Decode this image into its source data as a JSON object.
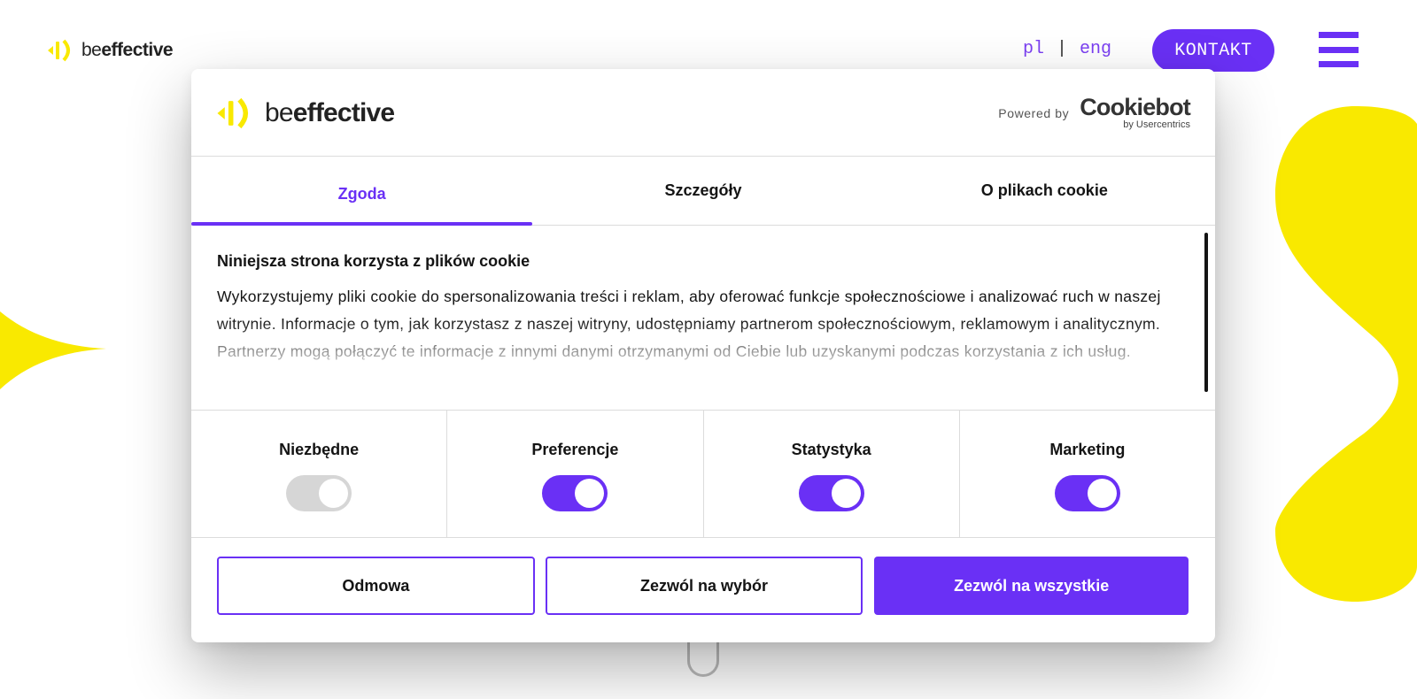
{
  "colors": {
    "accent": "#6a30f5",
    "brand_yellow": "#f9e900",
    "text": "#141414",
    "disabled_toggle": "#d6d6d6"
  },
  "site": {
    "logo": {
      "prefix": "be",
      "suffix": "effective",
      "icon": "beeffective-logo-icon"
    },
    "languages": [
      "pl",
      "eng"
    ],
    "language_separator": "|",
    "contact_button": "KONTAKT",
    "menu_icon": "hamburger-menu-icon"
  },
  "dialog": {
    "logo": {
      "prefix": "be",
      "suffix": "effective"
    },
    "powered_by": {
      "label": "Powered by",
      "brand": "Cookiebot",
      "brand_sub": "by Usercentrics"
    },
    "tabs": [
      {
        "label": "Zgoda",
        "active": true
      },
      {
        "label": "Szczegóły",
        "active": false
      },
      {
        "label": "O plikach cookie",
        "active": false
      }
    ],
    "title": "Niniejsza strona korzysta z plików cookie",
    "body": "Wykorzystujemy pliki cookie do spersonalizowania treści i reklam, aby oferować funkcje społecznościowe i analizować ruch w naszej witrynie. Informacje o tym, jak korzystasz z naszej witryny, udostępniamy partnerom społecznościowym, reklamowym i analitycznym. Partnerzy mogą połączyć te informacje z innymi danymi otrzymanymi od Ciebie lub uzyskanymi podczas korzystania z ich usług.",
    "categories": [
      {
        "label": "Niezbędne",
        "enabled": true,
        "locked": true
      },
      {
        "label": "Preferencje",
        "enabled": true,
        "locked": false
      },
      {
        "label": "Statystyka",
        "enabled": true,
        "locked": false
      },
      {
        "label": "Marketing",
        "enabled": true,
        "locked": false
      }
    ],
    "buttons": {
      "deny": "Odmowa",
      "allow_selection": "Zezwól na wybór",
      "allow_all": "Zezwól na wszystkie"
    }
  }
}
